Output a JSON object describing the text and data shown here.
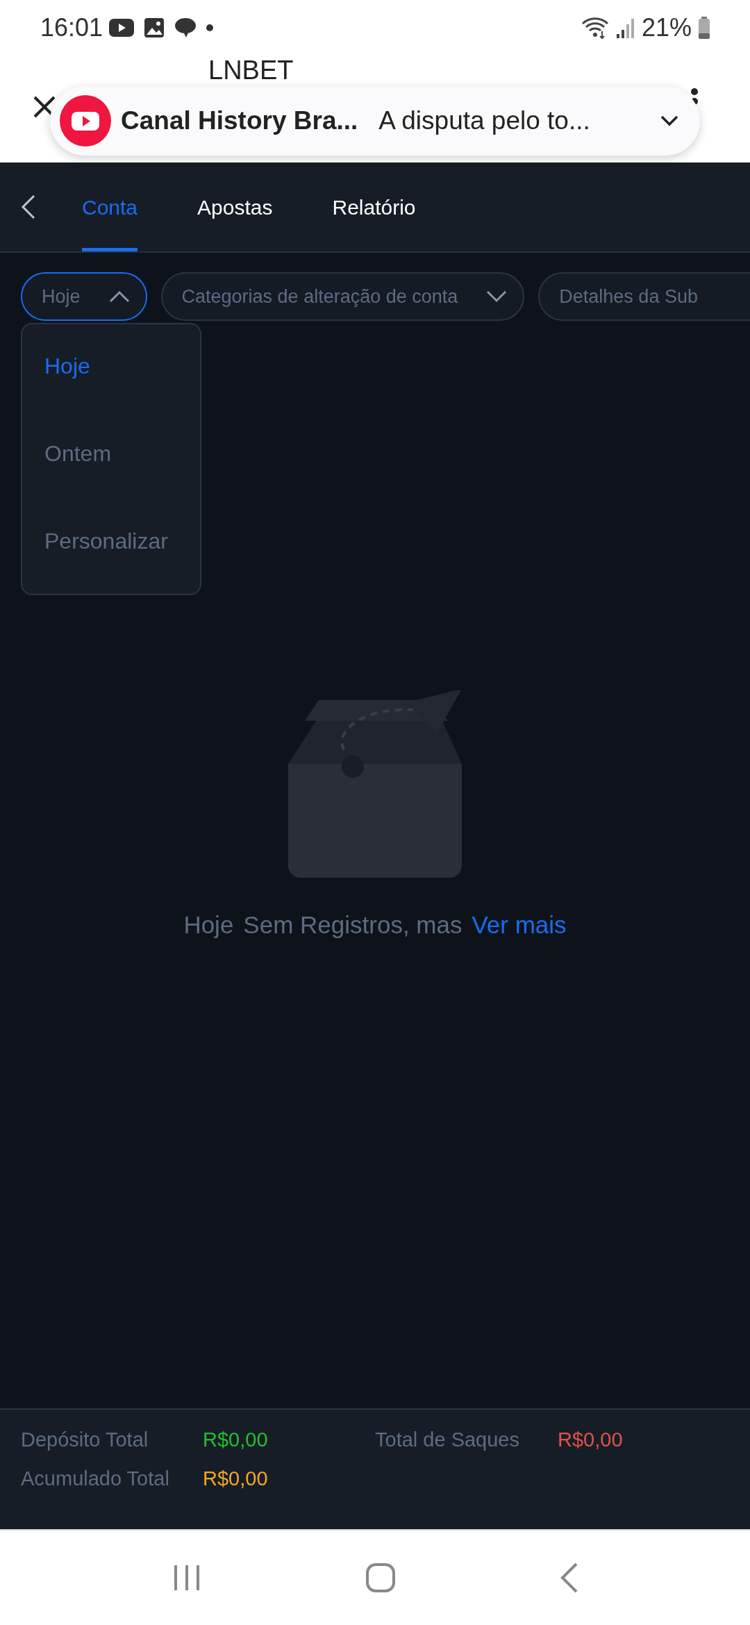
{
  "status_bar": {
    "time": "16:01",
    "battery": "21%"
  },
  "browser": {
    "title": "LNBET"
  },
  "notification": {
    "channel": "Canal History Bra...",
    "text": "A disputa pelo to..."
  },
  "tabs": [
    {
      "label": "Conta",
      "selected": true
    },
    {
      "label": "Apostas",
      "selected": false
    },
    {
      "label": "Relatório",
      "selected": false
    }
  ],
  "filters": [
    {
      "label": "Hoje",
      "expanded": true
    },
    {
      "label": "Categorias de alteração de conta",
      "expanded": false
    },
    {
      "label": "Detalhes da Sub"
    }
  ],
  "dropdown": [
    {
      "label": "Hoje",
      "selected": true
    },
    {
      "label": "Ontem",
      "selected": false
    },
    {
      "label": "Personalizar",
      "selected": false
    }
  ],
  "empty_state": {
    "period": "Hoje",
    "message": "Sem Registros, mas",
    "link": "Ver mais"
  },
  "totals": [
    {
      "label": "Depósito Total",
      "value": "R$0,00",
      "color": "#22c02a"
    },
    {
      "label": "Total de Saques",
      "value": "R$0,00",
      "color": "#e0534a"
    },
    {
      "label": "Acumulado Total",
      "value": "R$0,00",
      "color": "#f5a623"
    }
  ]
}
